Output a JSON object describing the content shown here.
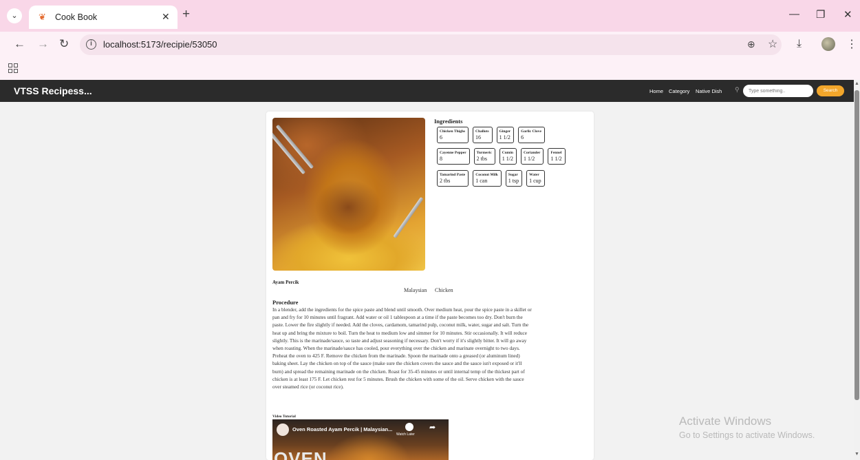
{
  "browser": {
    "tab_title": "Cook Book",
    "url": "localhost:5173/recipie/53050"
  },
  "app": {
    "brand": "VTSS Recipess...",
    "nav": [
      "Home",
      "Category",
      "Native Dish"
    ],
    "search_placeholder": "Type something..",
    "search_button": "Search"
  },
  "recipe": {
    "ingredients_title": "Ingredients",
    "ingredient_rows": [
      [
        {
          "name": "Chicken Thighs",
          "qty": "6"
        },
        {
          "name": "Challots",
          "qty": "16"
        },
        {
          "name": "Ginger",
          "qty": "1 1/2"
        },
        {
          "name": "Garlic Clove",
          "qty": "6"
        }
      ],
      [
        {
          "name": "Cayenne Pepper",
          "qty": "8"
        },
        {
          "name": "Turmeric",
          "qty": "2 tbs"
        },
        {
          "name": "Cumin",
          "qty": "1 1/2"
        },
        {
          "name": "Coriander",
          "qty": "1 1/2"
        },
        {
          "name": "Fennel",
          "qty": "1 1/2"
        }
      ],
      [
        {
          "name": "Tamarind Paste",
          "qty": "2 tbs"
        },
        {
          "name": "Coconut Milk",
          "qty": "1 can"
        },
        {
          "name": "Sugar",
          "qty": "1 tsp"
        },
        {
          "name": "Water",
          "qty": "1 cup"
        }
      ]
    ],
    "name": "Ayam Percik",
    "area": "Malaysian",
    "category": "Chicken",
    "procedure_title": "Procedure",
    "procedure_lines": [
      "In a blender, add the ingredients for the spice paste and blend until smooth. Over medium heat, pour the spice paste in a skillet or",
      "pan and fry for 10 minutes until fragrant. Add water or oil 1 tablespoon at a time if the paste becomes too dry. Don't burn the",
      "paste. Lower the fire slightly if needed. Add the cloves, cardamom, tamarind pulp, coconut milk, water, sugar and salt. Turn the",
      "heat up and bring the mixture to boil. Turn the heat to medium low and simmer for 10 minutes. Stir occasionally. It will reduce",
      "slightly. This is the marinade/sauce, so taste and adjust seasoning if necessary. Don't worry if it's slightly bitter. It will go away",
      "when roasting. When the marinade/sauce has cooled, pour everything over the chicken and marinate overnight to two days.",
      "Preheat the oven to 425 F. Remove the chicken from the marinade. Spoon the marinade onto a greased (or aluminum lined)",
      "baking sheet. Lay the chicken on top of the sauce (make sure the chicken covers the sauce and the sauce isn't exposed or it'll",
      "burn) and spread the remaining marinade on the chicken. Roast for 35-45 minutes or until internal temp of the thickest part of",
      "chicken is at least 175 F. Let chicken rest for 5 minutes. Brush the chicken with some of the oil. Serve chicken with the sauce",
      "over steamed rice (or coconut rice)."
    ],
    "video_label": "Video Tutorial",
    "video_title": "Oven Roasted Ayam Percik | Malaysian...",
    "video_watch_later": "Watch Later",
    "video_big_text": "OVEN"
  },
  "watermark": {
    "title": "Activate Windows",
    "subtitle": "Go to Settings to activate Windows."
  }
}
